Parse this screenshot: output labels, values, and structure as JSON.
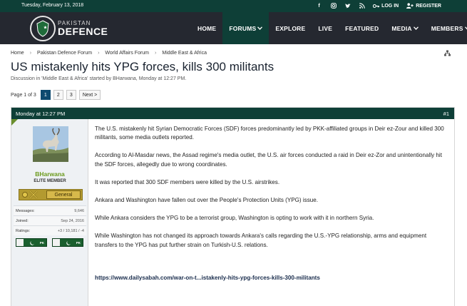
{
  "topbar": {
    "date": "Tuesday, February 13, 2018",
    "social_icons": [
      "facebook-icon",
      "instagram-icon",
      "twitter-icon",
      "rss-icon"
    ],
    "login_label": "LOG IN",
    "register_label": "REGISTER"
  },
  "header": {
    "logo_line1": "PAKISTAN",
    "logo_line2": "DEFENCE",
    "nav": [
      {
        "label": "HOME",
        "active": false,
        "dropdown": false
      },
      {
        "label": "FORUMS",
        "active": true,
        "dropdown": true
      },
      {
        "label": "EXPLORE",
        "active": false,
        "dropdown": false
      },
      {
        "label": "LIVE",
        "active": false,
        "dropdown": false
      },
      {
        "label": "FEATURED",
        "active": false,
        "dropdown": false
      },
      {
        "label": "MEDIA",
        "active": false,
        "dropdown": true
      },
      {
        "label": "MEMBERS",
        "active": false,
        "dropdown": true
      }
    ]
  },
  "breadcrumb": [
    "Home",
    "Pakistan Defence Forum",
    "World Affairs Forum",
    "Middle East & Africa"
  ],
  "thread": {
    "title": "US mistakenly hits YPG forces, kills 300 militants",
    "meta": "Discussion in 'Middle East & Africa' started by BHarwana, Monday at 12:27 PM."
  },
  "pagination": {
    "info": "Page 1 of 3",
    "pages": [
      "1",
      "2",
      "3"
    ],
    "current": "1",
    "next_label": "Next >"
  },
  "post": {
    "date": "Monday at 12:27 PM",
    "number": "#1",
    "author": {
      "name": "BHarwana",
      "title": "ELITE MEMBER",
      "rank": "General",
      "stats": [
        {
          "label": "Messages:",
          "value": "9,646"
        },
        {
          "label": "Joined:",
          "value": "Sep 24, 2016"
        },
        {
          "label": "Ratings:",
          "value": "+3 / 10,181 / -4"
        }
      ],
      "flags": [
        "PK",
        "PK"
      ]
    },
    "paragraphs": [
      "The U.S. mistakenly hit Syrian Democratic Forces (SDF) forces predominantly led by PKK-affiliated groups in Deir ez-Zour and killed 300 militants, some media outlets reported.",
      "According to Al-Masdar news, the Assad regime's media outlet, the U.S. air forces conducted a raid in Deir ez-Zor and unintentionally hit the SDF forces, allegedly due to wrong coordinates.",
      "It was reported that 300 SDF members were killed by the U.S. airstrikes.",
      "Ankara and Washington have fallen out over the People's Protection Units (YPG) issue.",
      "While Ankara considers the YPG to be a terrorist group, Washington is opting to work with it in northern Syria.",
      "While Washington has not changed its approach towards Ankara's calls regarding the U.S.-YPG relationship, arms and equipment transfers to the YPG has put further strain on Turkish-U.S. relations."
    ],
    "link": "https://www.dailysabah.com/war-on-t...istakenly-hits-ypg-forces-kills-300-militants"
  }
}
